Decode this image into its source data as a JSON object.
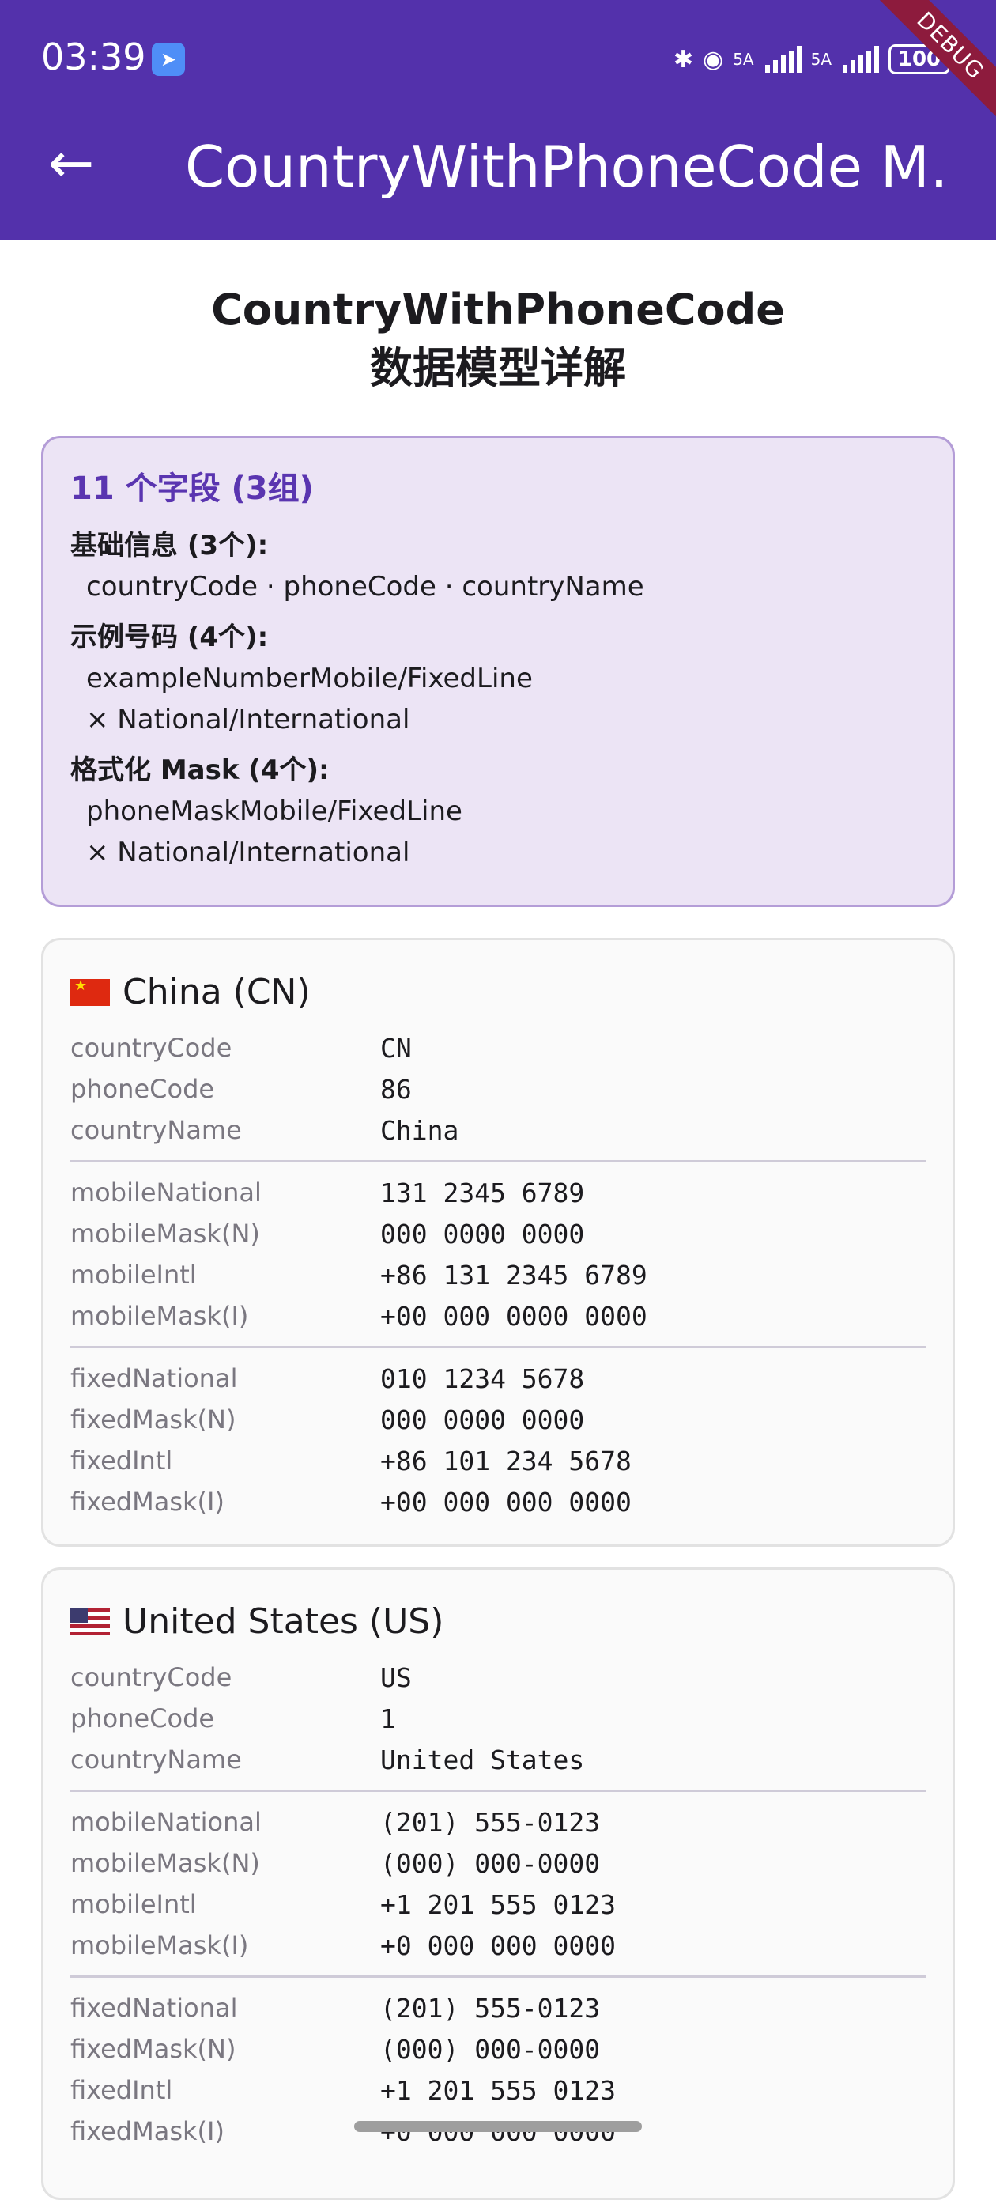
{
  "status_bar": {
    "time": "03:39",
    "battery": "100",
    "signal_label_1": "5A",
    "signal_label_2": "5A"
  },
  "app_bar": {
    "title": "CountryWithPhoneCode M…",
    "back_icon": "arrow-left-icon",
    "debug_banner": "DEBUG",
    "background_color": "#5331ab"
  },
  "page": {
    "title_line1": "CountryWithPhoneCode",
    "title_line2": "数据模型详解"
  },
  "summary": {
    "title": "11 个字段 (3组)",
    "groups": [
      {
        "label": "基础信息 (3个):",
        "lines": [
          "countryCode · phoneCode · countryName"
        ]
      },
      {
        "label": "示例号码 (4个):",
        "lines": [
          "exampleNumberMobile/FixedLine",
          "× National/International"
        ]
      },
      {
        "label": "格式化 Mask (4个):",
        "lines": [
          "phoneMaskMobile/FixedLine",
          "× National/International"
        ]
      }
    ]
  },
  "cards": [
    {
      "title": "China (CN)",
      "flag": "cn-flag-icon",
      "sections": [
        [
          {
            "label": "countryCode",
            "value": "CN"
          },
          {
            "label": "phoneCode",
            "value": "86"
          },
          {
            "label": "countryName",
            "value": "China"
          }
        ],
        [
          {
            "label": "mobileNational",
            "value": "131 2345 6789"
          },
          {
            "label": "mobileMask(N)",
            "value": "000 0000 0000"
          },
          {
            "label": "mobileIntl",
            "value": "+86 131 2345 6789"
          },
          {
            "label": "mobileMask(I)",
            "value": "+00 000 0000 0000"
          }
        ],
        [
          {
            "label": "fixedNational",
            "value": "010 1234 5678"
          },
          {
            "label": "fixedMask(N)",
            "value": "000 0000 0000"
          },
          {
            "label": "fixedIntl",
            "value": "+86 101 234 5678"
          },
          {
            "label": "fixedMask(I)",
            "value": "+00 000 000 0000"
          }
        ]
      ]
    },
    {
      "title": "United States (US)",
      "flag": "us-flag-icon",
      "sections": [
        [
          {
            "label": "countryCode",
            "value": "US"
          },
          {
            "label": "phoneCode",
            "value": "1"
          },
          {
            "label": "countryName",
            "value": "United States"
          }
        ],
        [
          {
            "label": "mobileNational",
            "value": "(201) 555-0123"
          },
          {
            "label": "mobileMask(N)",
            "value": "(000) 000-0000"
          },
          {
            "label": "mobileIntl",
            "value": "+1 201 555 0123"
          },
          {
            "label": "mobileMask(I)",
            "value": "+0 000 000 0000"
          }
        ],
        [
          {
            "label": "fixedNational",
            "value": "(201) 555-0123"
          },
          {
            "label": "fixedMask(N)",
            "value": "(000) 000-0000"
          },
          {
            "label": "fixedIntl",
            "value": "+1 201 555 0123"
          },
          {
            "label": "fixedMask(I)",
            "value": "+0 000 000 0000"
          }
        ]
      ]
    }
  ]
}
